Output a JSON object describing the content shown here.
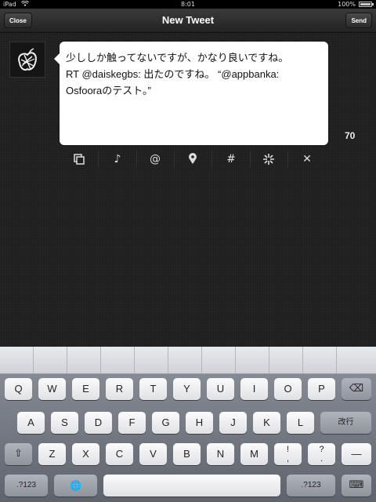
{
  "status_bar": {
    "carrier": "iPad",
    "time": "8:01",
    "battery": "100%"
  },
  "nav": {
    "title": "New Tweet",
    "close_label": "Close",
    "send_label": "Send"
  },
  "compose": {
    "lines": [
      "少ししか触ってないですが、かなり良いですね。",
      "RT @daiskegbs: 出たのですね。 “@appbanka:",
      "Osfooraのテスト。”"
    ],
    "char_count": "70"
  },
  "toolbar": {
    "tools": [
      {
        "name": "copy-icon",
        "glyph": "⧉"
      },
      {
        "name": "music-note-icon",
        "glyph": "♪"
      },
      {
        "name": "mention-icon",
        "glyph": "@"
      },
      {
        "name": "location-pin-icon",
        "glyph": "⬤"
      },
      {
        "name": "hashtag-icon",
        "glyph": "#"
      },
      {
        "name": "shorten-link-icon",
        "glyph": "✣"
      },
      {
        "name": "clear-icon",
        "glyph": "✕"
      }
    ]
  },
  "keyboard": {
    "row1": [
      "Q",
      "W",
      "E",
      "R",
      "T",
      "Y",
      "U",
      "I",
      "O",
      "P"
    ],
    "row2": [
      "A",
      "S",
      "D",
      "F",
      "G",
      "H",
      "J",
      "K",
      "L"
    ],
    "row3": [
      "Z",
      "X",
      "C",
      "V",
      "B",
      "N",
      "M"
    ],
    "row3_punct": [
      {
        "top": "!",
        "bottom": ","
      },
      {
        "top": "?",
        "bottom": "."
      }
    ],
    "dash": "—",
    "return_label": "改行",
    "numbers_label": ".?123",
    "backspace_glyph": "⌫",
    "shift_glyph": "⇧",
    "globe_glyph": "🌐",
    "dismiss_glyph": "⌨"
  }
}
